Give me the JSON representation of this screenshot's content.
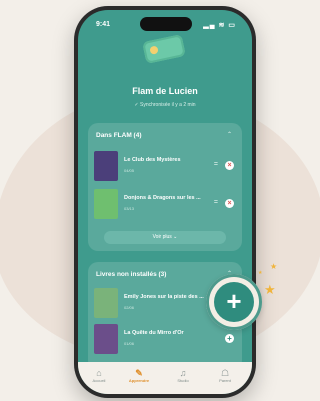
{
  "status": {
    "time": "9:41",
    "icons": "▂▄ ≋ ▭"
  },
  "header": {
    "title": "Flam de Lucien",
    "subtitle": "✓ Synchronisée il y a 2 min"
  },
  "section_installed": {
    "title": "Dans FLAM (4)",
    "chevron": "⌃",
    "items": [
      {
        "title": "Le Club des Mystères",
        "meta": "04/05",
        "cover_color": "#4b3f7a"
      },
      {
        "title": "Donjons & Dragons sur les ...",
        "meta": "03/13",
        "cover_color": "#6fbf6f"
      }
    ],
    "more_label": "Voir plus ⌄"
  },
  "section_not_installed": {
    "title": "Livres non installés (3)",
    "chevron": "⌃",
    "items": [
      {
        "title": "Emily Jones sur la piste des ...",
        "meta": "02/06",
        "cover_color": "#7ab37a"
      },
      {
        "title": "La Quête du Mirro d'Or",
        "meta": "01/06",
        "cover_color": "#6b4e8a"
      }
    ]
  },
  "tabs": [
    {
      "label": "Accueil",
      "icon": "⌂",
      "active": false
    },
    {
      "label": "Apprendre",
      "icon": "✎",
      "active": true
    },
    {
      "label": "Studio",
      "icon": "♫",
      "active": false
    },
    {
      "label": "Parent",
      "icon": "☖",
      "active": false
    }
  ],
  "fab": {
    "label": "+"
  }
}
